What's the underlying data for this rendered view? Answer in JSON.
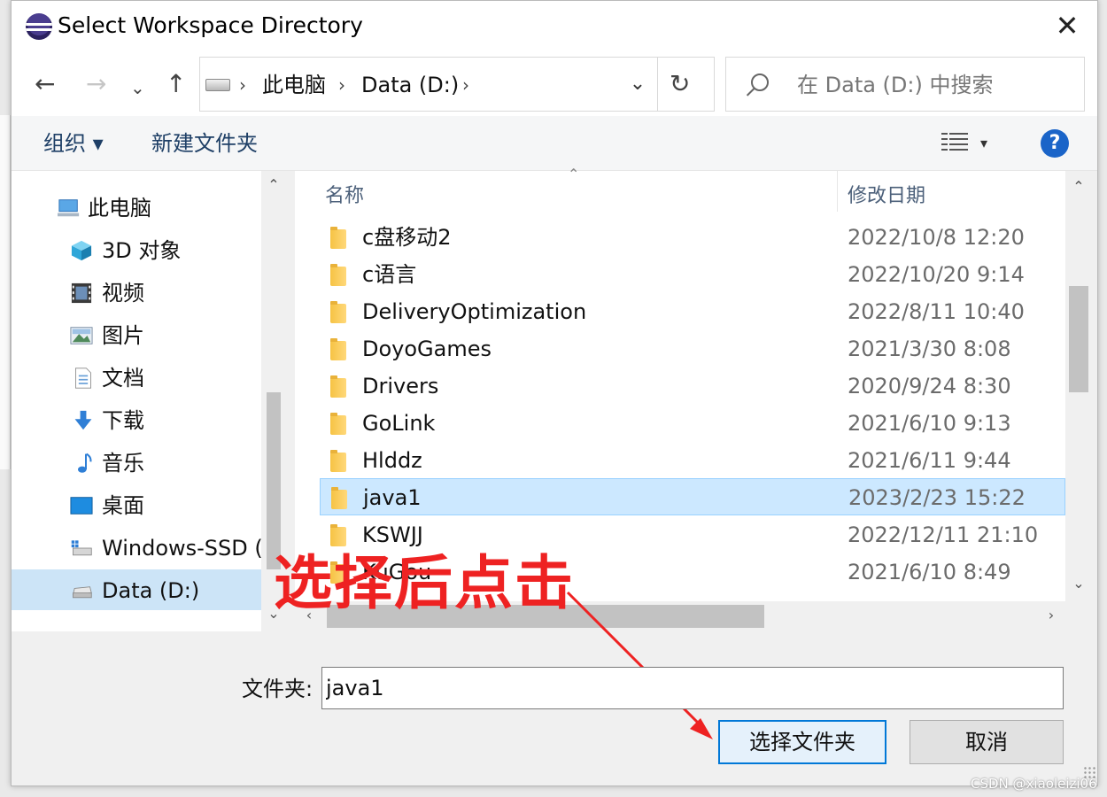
{
  "window": {
    "title": "Select Workspace Directory",
    "app_icon": "eclipse-icon",
    "close_glyph": "✕"
  },
  "nav": {
    "back": "←",
    "forward": "→",
    "recent": "⌄",
    "up": "↑",
    "refresh": "↻",
    "dropdown": "⌄"
  },
  "address": {
    "crumbs": [
      "此电脑",
      "Data (D:)"
    ],
    "separator": "›"
  },
  "search": {
    "placeholder": "在 Data (D:) 中搜索"
  },
  "toolbar": {
    "organize": "组织 ▾",
    "new_folder": "新建文件夹",
    "view_dropdown": "▾",
    "help": "?"
  },
  "sidebar": {
    "items": [
      {
        "label": "此电脑",
        "icon": "computer-icon"
      },
      {
        "label": "3D 对象",
        "icon": "cube-icon"
      },
      {
        "label": "视频",
        "icon": "video-icon"
      },
      {
        "label": "图片",
        "icon": "picture-icon"
      },
      {
        "label": "文档",
        "icon": "document-icon"
      },
      {
        "label": "下载",
        "icon": "download-icon"
      },
      {
        "label": "音乐",
        "icon": "music-icon"
      },
      {
        "label": "桌面",
        "icon": "desktop-icon"
      },
      {
        "label": "Windows-SSD (",
        "icon": "drive-icon"
      },
      {
        "label": "Data (D:)",
        "icon": "drive-icon",
        "selected": true
      }
    ]
  },
  "columns": {
    "name": "名称",
    "modified": "修改日期"
  },
  "files": [
    {
      "name": "c盘移动2",
      "modified": "2022/10/8 12:20"
    },
    {
      "name": "c语言",
      "modified": "2022/10/20 9:14"
    },
    {
      "name": "DeliveryOptimization",
      "modified": "2022/8/11 10:40"
    },
    {
      "name": "DoyoGames",
      "modified": "2021/3/30 8:08"
    },
    {
      "name": "Drivers",
      "modified": "2020/9/24 8:30"
    },
    {
      "name": "GoLink",
      "modified": "2021/6/10 9:13"
    },
    {
      "name": "Hlddz",
      "modified": "2021/6/11 9:44"
    },
    {
      "name": "java1",
      "modified": "2023/2/23 15:22",
      "selected": true
    },
    {
      "name": "KSWJJ",
      "modified": "2022/12/11 21:10"
    },
    {
      "name": "KuGou",
      "modified": "2021/6/10 8:49"
    }
  ],
  "annotation": {
    "text": "选择后点击",
    "color": "#ee2222"
  },
  "footer": {
    "folder_label": "文件夹:",
    "folder_value": "java1",
    "select_button": "选择文件夹",
    "cancel_button": "取消"
  },
  "watermark": "CSDN @xiaoleizi06",
  "colors": {
    "selection": "#cce8ff",
    "accent": "#0078d7",
    "help": "#1a64c8"
  }
}
